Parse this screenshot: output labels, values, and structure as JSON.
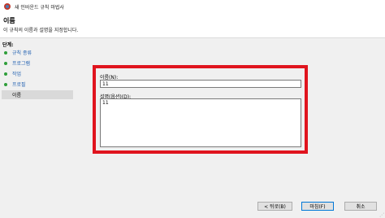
{
  "window": {
    "title": "새 인바운드 규칙 마법사",
    "minimize_glyph": "—",
    "maximize_glyph": "☐",
    "close_glyph": "✕"
  },
  "header": {
    "title": "이름",
    "subtitle": "이 규칙의 이름과 설명을 지정합니다."
  },
  "sidebar": {
    "title": "단계:",
    "items": [
      {
        "label": "규칙 종류"
      },
      {
        "label": "프로그램"
      },
      {
        "label": "작업"
      },
      {
        "label": "프로필"
      },
      {
        "label": "이름"
      }
    ]
  },
  "form": {
    "name_label": "이름(N):",
    "name_value": "11",
    "desc_label": "설명(옵션)(D):",
    "desc_value": "11"
  },
  "buttons": {
    "back": "< 뒤로(B)",
    "next": "마침(F)",
    "cancel": "취소"
  },
  "colors": {
    "highlight": "#e0141e",
    "step_dot": "#2e9e3a",
    "link": "#2060b0"
  }
}
